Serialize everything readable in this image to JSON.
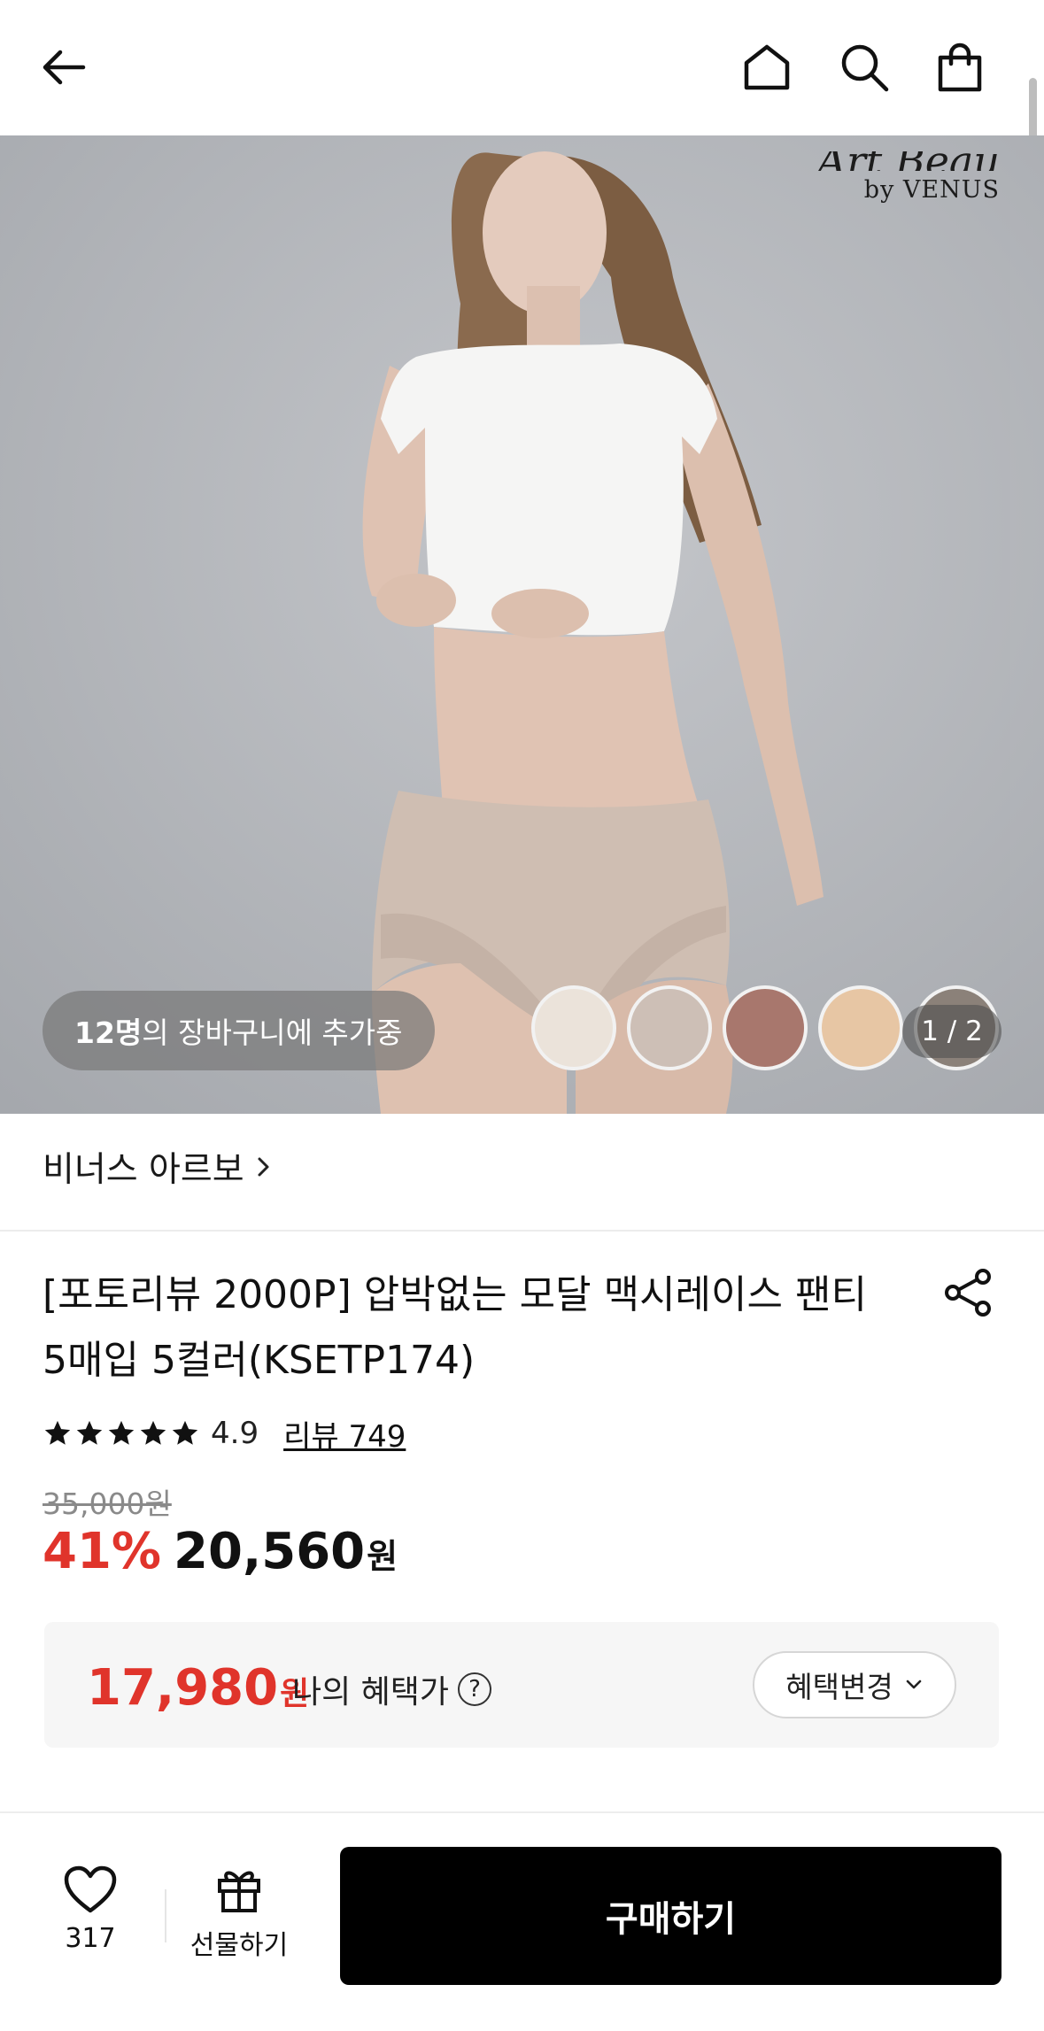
{
  "topbar": {
    "back_icon": "arrow-left-icon",
    "home_icon": "home-icon",
    "search_icon": "search-icon",
    "cart_icon": "shopping-bag-icon"
  },
  "hero": {
    "brand_logo_script": "Art Beau",
    "brand_logo_sub": "by VENUS",
    "cart_count": "12명",
    "cart_text": "의 장바구니에 추가중",
    "page_indicator": "1 / 2",
    "swatch_colors": [
      "#ebe3da",
      "#cdbfb6",
      "#a8776d",
      "#e7c6a4",
      "#8b8179"
    ]
  },
  "brand": {
    "name": "비너스 아르보",
    "chevron_icon": "chevron-right-icon"
  },
  "product": {
    "title": "[포토리뷰 2000P] 압박없는 모달 맥시레이스 팬티 5매입 5컬러(KSETP174)",
    "share_icon": "share-icon",
    "rating": "4.9",
    "stars": 5,
    "review_label": "리뷰 749",
    "original_price": "35,000원",
    "discount": "41%",
    "price": "20,560",
    "price_unit": "원"
  },
  "benefit": {
    "price": "17,980",
    "price_unit": "원",
    "label": "나의 혜택가",
    "help_icon": "question-circle-icon",
    "change_button": "혜택변경",
    "accent_color": "#e0342b"
  },
  "bottom": {
    "like_icon": "heart-icon",
    "like_count": "317",
    "gift_icon": "gift-icon",
    "gift_label": "선물하기",
    "buy_label": "구매하기"
  }
}
